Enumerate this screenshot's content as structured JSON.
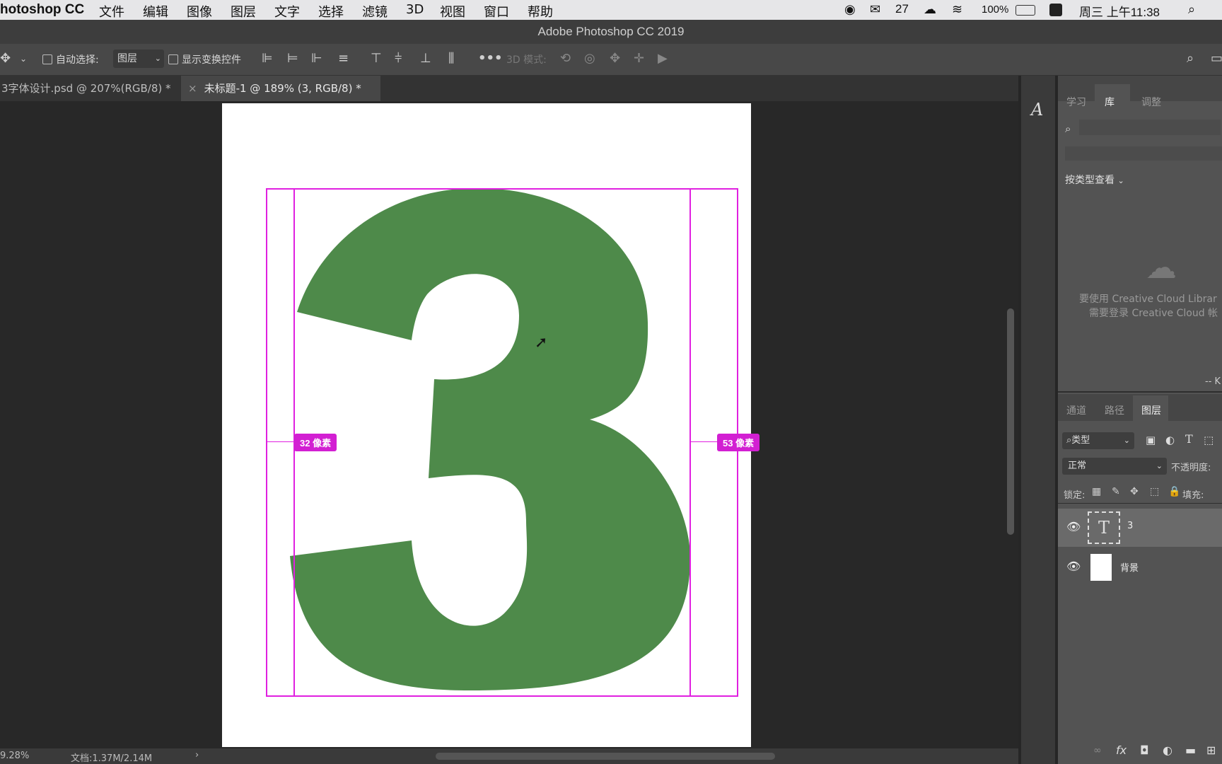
{
  "menubar": {
    "app": "hotoshop CC",
    "items": [
      "文件",
      "编辑",
      "图像",
      "图层",
      "文字",
      "选择",
      "滤镜",
      "3D",
      "视图",
      "窗口",
      "帮助"
    ],
    "wechat_count": "27",
    "battery": "100%",
    "clock": "周三 上午11:38"
  },
  "window_title": "Adobe Photoshop CC 2019",
  "options": {
    "auto_select": "自动选择:",
    "auto_select_target": "图层",
    "show_transform": "显示变换控件",
    "mode_3d": "3D 模式:"
  },
  "tabs": [
    {
      "label": "3字体设计.psd @ 207%(RGB/8) *"
    },
    {
      "label": "未标题-1 @ 189% (3, RGB/8) *"
    }
  ],
  "canvas": {
    "glyph": "3",
    "glyph_color": "#4e8a4a",
    "guide_color": "#e020e0",
    "left_measure": "32 像素",
    "right_measure": "53 像素"
  },
  "statusbar": {
    "zoom": "9.28%",
    "doc_size": "文档:1.37M/2.14M"
  },
  "library_panel": {
    "tabs": [
      "学习",
      "库",
      "调整"
    ],
    "view_by": "按类型查看",
    "message_line1": "要使用 Creative Cloud Librar",
    "message_line2": "需要登录 Creative Cloud 帐",
    "footer": "-- K"
  },
  "layers_panel": {
    "tabs": [
      "通道",
      "路径",
      "图层"
    ],
    "filter": "类型",
    "blend_mode": "正常",
    "opacity_label": "不透明度:",
    "lock_label": "锁定:",
    "fill_label": "填充:",
    "layers": [
      {
        "name": "3",
        "type": "text"
      },
      {
        "name": "背景",
        "type": "background"
      }
    ]
  }
}
